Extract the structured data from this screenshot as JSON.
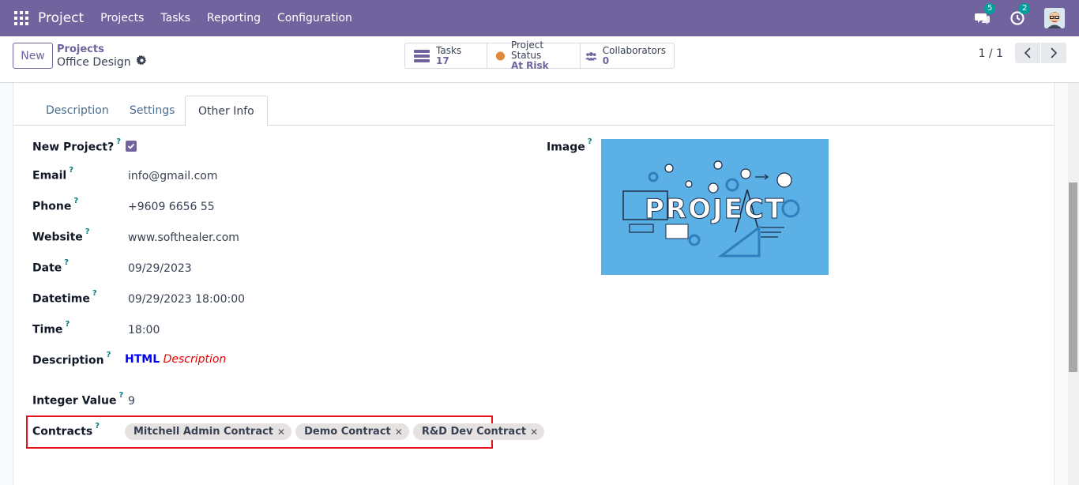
{
  "navbar": {
    "brand": "Project",
    "menu": [
      "Projects",
      "Tasks",
      "Reporting",
      "Configuration"
    ],
    "messages_count": "5",
    "activities_count": "2"
  },
  "control": {
    "new_label": "New",
    "breadcrumb_parent": "Projects",
    "breadcrumb_current": "Office Design",
    "stats": [
      {
        "label": "Tasks",
        "value": "17"
      },
      {
        "label": "Project Status",
        "value": "At Risk"
      },
      {
        "label": "Collaborators",
        "value": "0"
      }
    ],
    "pager": "1 / 1"
  },
  "tabs": [
    "Description",
    "Settings",
    "Other Info"
  ],
  "active_tab": "Other Info",
  "fields": {
    "new_project": {
      "label": "New Project?",
      "checked": true
    },
    "email": {
      "label": "Email",
      "value": "info@gmail.com"
    },
    "phone": {
      "label": "Phone",
      "value": "+9609 6656 55"
    },
    "website": {
      "label": "Website",
      "value": "www.softhealer.com"
    },
    "date": {
      "label": "Date",
      "value": "09/29/2023"
    },
    "datetime": {
      "label": "Datetime",
      "value": "09/29/2023 18:00:00"
    },
    "time": {
      "label": "Time",
      "value": "18:00"
    },
    "description": {
      "label": "Description",
      "html_bold": "HTML",
      "html_italic": "Description"
    },
    "integer_value": {
      "label": "Integer Value",
      "value": "9"
    },
    "contracts": {
      "label": "Contracts",
      "tags": [
        "Mitchell Admin Contract",
        "Demo Contract",
        "R&D Dev Contract"
      ]
    },
    "image": {
      "label": "Image",
      "text": "PROJECT"
    }
  },
  "help_mark": "?",
  "colors": {
    "primary": "#71639e",
    "status_at_risk": "#e0883b",
    "highlight": "#e3121b",
    "image_bg": "#5bb1e6"
  }
}
